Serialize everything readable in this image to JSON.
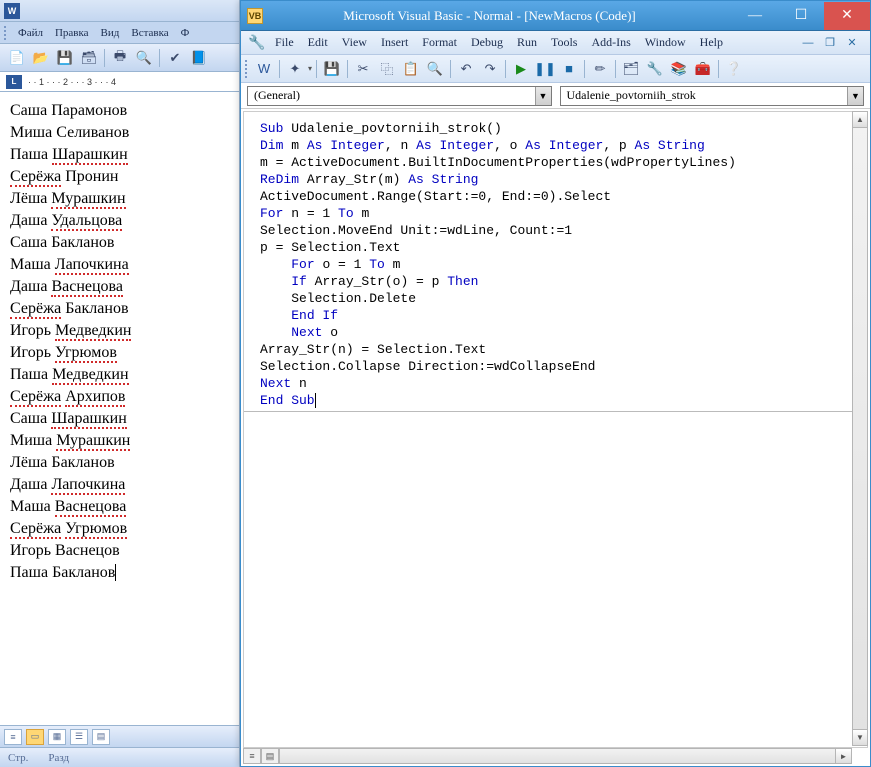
{
  "word": {
    "icon_letter": "W",
    "menu": [
      "Файл",
      "Правка",
      "Вид",
      "Вставка",
      "Ф"
    ],
    "toolbar_icons": [
      "new-icon",
      "open-icon",
      "save-icon",
      "saveall-icon",
      "print-icon",
      "printpreview-icon",
      "spellcheck-icon",
      "research-icon"
    ],
    "ruler_text": "· · 1 · · · 2 · · · 3 · · · 4",
    "names": [
      "Саша Парамонов",
      "Миша Селиванов",
      "Паша Шарашкин",
      "Серёжа Пронин",
      "Лёша Мурашкин",
      "Даша Удальцова",
      "Саша Бакланов",
      "Маша Лапочкина",
      "Даша Васнецова",
      "Серёжа Бакланов",
      "Игорь Медведкин",
      "Игорь Угрюмов",
      "Паша Медведкин",
      "Серёжа Архипов",
      "Саша Шарашкин",
      "Миша Мурашкин",
      "Лёша Бакланов",
      "Даша Лапочкина",
      "Маша Васнецова",
      "Серёжа Угрюмов",
      "Игорь Васнецов",
      "Паша Бакланов"
    ],
    "status": {
      "page_label": "Стр.",
      "section_label": "Разд"
    }
  },
  "vbe": {
    "title": "Microsoft Visual Basic - Normal - [NewMacros (Code)]",
    "menu": [
      "File",
      "Edit",
      "View",
      "Insert",
      "Format",
      "Debug",
      "Run",
      "Tools",
      "Add-Ins",
      "Window",
      "Help"
    ],
    "toolbar_icons": [
      "word-icon",
      "insertmod-icon",
      "save-icon",
      "cut-icon",
      "copy-icon",
      "paste-icon",
      "find-icon",
      "undo-icon",
      "redo-icon",
      "run-icon",
      "break-icon",
      "reset-icon",
      "design-icon",
      "explorer-icon",
      "props-icon",
      "browser-icon",
      "toolbox-icon",
      "help-icon"
    ],
    "combo_object": "(General)",
    "combo_proc": "Udalenie_povtorniih_strok",
    "code": [
      {
        "t": "Sub ",
        "k": 1,
        "r": "Udalenie_povtorniih_strok()"
      },
      {
        "pre": "Dim ",
        "k": 1,
        "segs": [
          [
            "m ",
            0
          ],
          [
            "As Integer",
            1
          ],
          [
            ", n ",
            0
          ],
          [
            "As Integer",
            1
          ],
          [
            ", o ",
            0
          ],
          [
            "As Integer",
            1
          ],
          [
            ", p ",
            0
          ],
          [
            "As String",
            1
          ]
        ]
      },
      {
        "r": "m = ActiveDocument.BuiltInDocumentProperties(wdPropertyLines)"
      },
      {
        "segs": [
          [
            "ReDim ",
            1
          ],
          [
            "Array_Str(m) ",
            0
          ],
          [
            "As String",
            1
          ]
        ]
      },
      {
        "r": "ActiveDocument.Range(Start:=0, End:=0).Select"
      },
      {
        "segs": [
          [
            "For ",
            1
          ],
          [
            "n = 1 ",
            0
          ],
          [
            "To ",
            1
          ],
          [
            "m",
            0
          ]
        ]
      },
      {
        "r": "Selection.MoveEnd Unit:=wdLine, Count:=1"
      },
      {
        "r": "p = Selection.Text"
      },
      {
        "indent": 1,
        "segs": [
          [
            "For ",
            1
          ],
          [
            "o = 1 ",
            0
          ],
          [
            "To ",
            1
          ],
          [
            "m",
            0
          ]
        ]
      },
      {
        "indent": 1,
        "segs": [
          [
            "If ",
            1
          ],
          [
            "Array_Str(o) = p ",
            0
          ],
          [
            "Then",
            1
          ]
        ]
      },
      {
        "indent": 1,
        "r": "Selection.Delete"
      },
      {
        "indent": 1,
        "segs": [
          [
            "End If",
            1
          ]
        ]
      },
      {
        "indent": 1,
        "segs": [
          [
            "Next ",
            1
          ],
          [
            "o",
            0
          ]
        ]
      },
      {
        "r": "Array_Str(n) = Selection.Text"
      },
      {
        "r": "Selection.Collapse Direction:=wdCollapseEnd"
      },
      {
        "segs": [
          [
            "Next ",
            1
          ],
          [
            "n",
            0
          ]
        ]
      },
      {
        "segs": [
          [
            "End Sub",
            1
          ]
        ],
        "caret": true
      }
    ]
  }
}
